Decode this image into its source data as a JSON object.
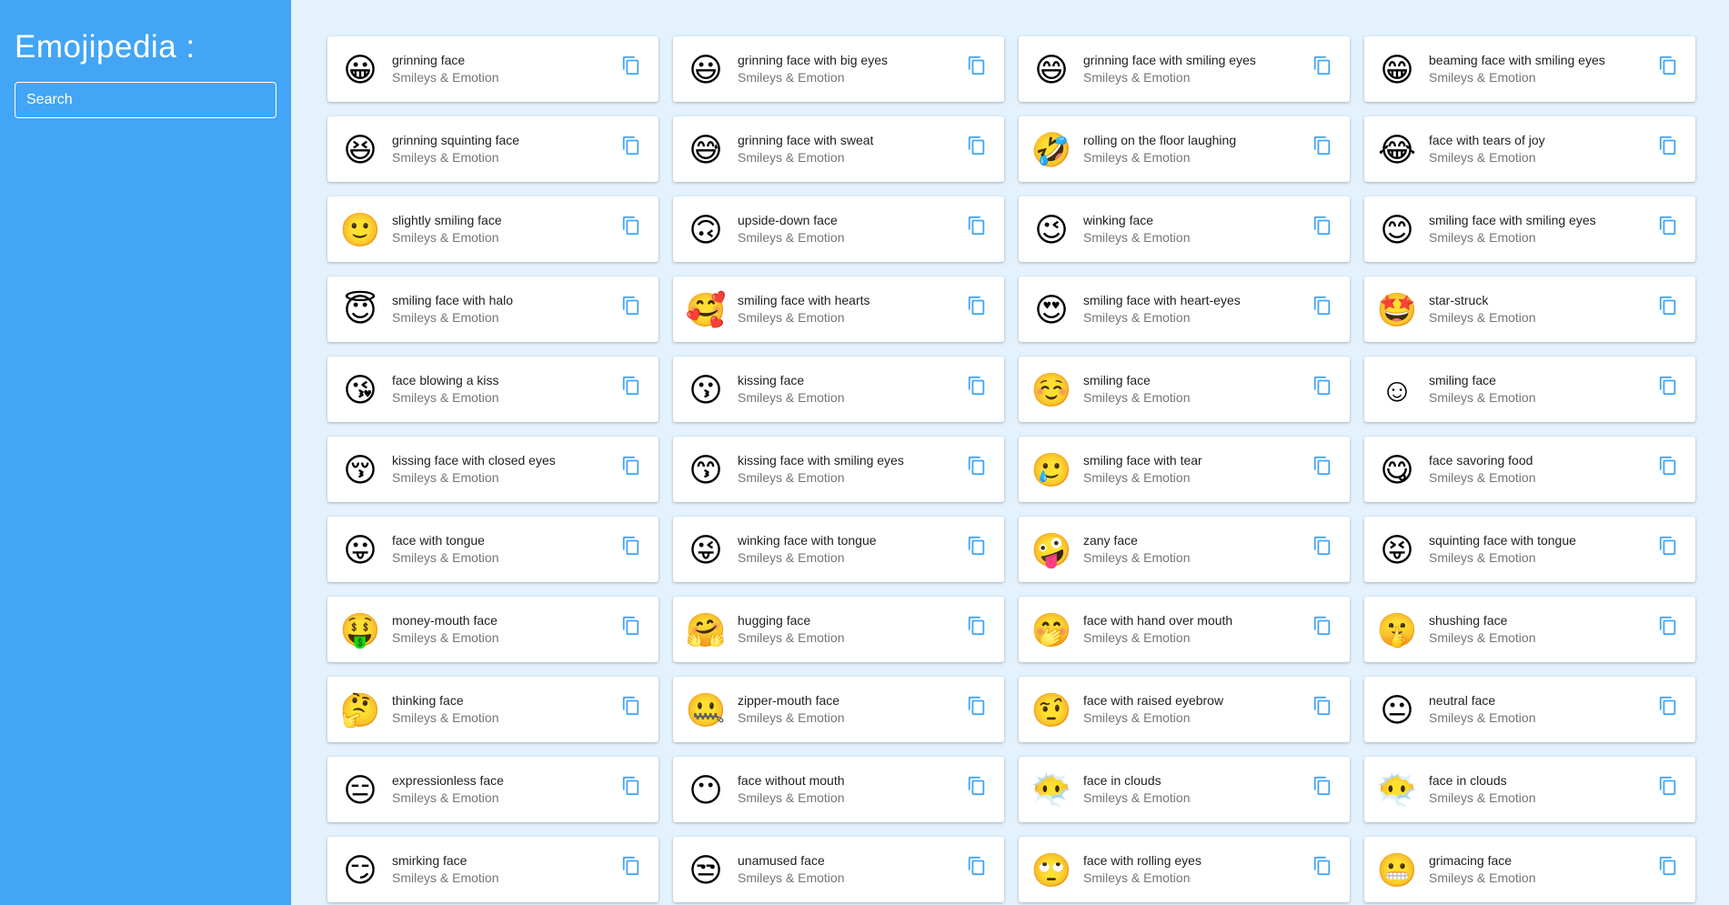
{
  "app": {
    "title": "Emojipedia :"
  },
  "search": {
    "placeholder": "Search",
    "value": ""
  },
  "colors": {
    "sidebar": "#42a5f5",
    "background": "#e3f2fd",
    "copy_icon": "#42a5f5"
  },
  "emojis": [
    {
      "emoji": "😀",
      "name": "grinning face",
      "category": "Smileys & Emotion"
    },
    {
      "emoji": "😃",
      "name": "grinning face with big eyes",
      "category": "Smileys & Emotion"
    },
    {
      "emoji": "😄",
      "name": "grinning face with smiling eyes",
      "category": "Smileys & Emotion"
    },
    {
      "emoji": "😁",
      "name": "beaming face with smiling eyes",
      "category": "Smileys & Emotion"
    },
    {
      "emoji": "😆",
      "name": "grinning squinting face",
      "category": "Smileys & Emotion"
    },
    {
      "emoji": "😅",
      "name": "grinning face with sweat",
      "category": "Smileys & Emotion"
    },
    {
      "emoji": "🤣",
      "name": "rolling on the floor laughing",
      "category": "Smileys & Emotion"
    },
    {
      "emoji": "😂",
      "name": "face with tears of joy",
      "category": "Smileys & Emotion"
    },
    {
      "emoji": "🙂",
      "name": "slightly smiling face",
      "category": "Smileys & Emotion"
    },
    {
      "emoji": "🙃",
      "name": "upside-down face",
      "category": "Smileys & Emotion"
    },
    {
      "emoji": "😉",
      "name": "winking face",
      "category": "Smileys & Emotion"
    },
    {
      "emoji": "😊",
      "name": "smiling face with smiling eyes",
      "category": "Smileys & Emotion"
    },
    {
      "emoji": "😇",
      "name": "smiling face with halo",
      "category": "Smileys & Emotion"
    },
    {
      "emoji": "🥰",
      "name": "smiling face with hearts",
      "category": "Smileys & Emotion"
    },
    {
      "emoji": "😍",
      "name": "smiling face with heart-eyes",
      "category": "Smileys & Emotion"
    },
    {
      "emoji": "🤩",
      "name": "star-struck",
      "category": "Smileys & Emotion"
    },
    {
      "emoji": "😘",
      "name": "face blowing a kiss",
      "category": "Smileys & Emotion"
    },
    {
      "emoji": "😗",
      "name": "kissing face",
      "category": "Smileys & Emotion"
    },
    {
      "emoji": "☺️",
      "name": "smiling face",
      "category": "Smileys & Emotion"
    },
    {
      "emoji": "☺",
      "name": "smiling face",
      "category": "Smileys & Emotion"
    },
    {
      "emoji": "😚",
      "name": "kissing face with closed eyes",
      "category": "Smileys & Emotion"
    },
    {
      "emoji": "😙",
      "name": "kissing face with smiling eyes",
      "category": "Smileys & Emotion"
    },
    {
      "emoji": "🥲",
      "name": "smiling face with tear",
      "category": "Smileys & Emotion"
    },
    {
      "emoji": "😋",
      "name": "face savoring food",
      "category": "Smileys & Emotion"
    },
    {
      "emoji": "😛",
      "name": "face with tongue",
      "category": "Smileys & Emotion"
    },
    {
      "emoji": "😜",
      "name": "winking face with tongue",
      "category": "Smileys & Emotion"
    },
    {
      "emoji": "🤪",
      "name": "zany face",
      "category": "Smileys & Emotion"
    },
    {
      "emoji": "😝",
      "name": "squinting face with tongue",
      "category": "Smileys & Emotion"
    },
    {
      "emoji": "🤑",
      "name": "money-mouth face",
      "category": "Smileys & Emotion"
    },
    {
      "emoji": "🤗",
      "name": "hugging face",
      "category": "Smileys & Emotion"
    },
    {
      "emoji": "🤭",
      "name": "face with hand over mouth",
      "category": "Smileys & Emotion"
    },
    {
      "emoji": "🤫",
      "name": "shushing face",
      "category": "Smileys & Emotion"
    },
    {
      "emoji": "🤔",
      "name": "thinking face",
      "category": "Smileys & Emotion"
    },
    {
      "emoji": "🤐",
      "name": "zipper-mouth face",
      "category": "Smileys & Emotion"
    },
    {
      "emoji": "🤨",
      "name": "face with raised eyebrow",
      "category": "Smileys & Emotion"
    },
    {
      "emoji": "😐",
      "name": "neutral face",
      "category": "Smileys & Emotion"
    },
    {
      "emoji": "😑",
      "name": "expressionless face",
      "category": "Smileys & Emotion"
    },
    {
      "emoji": "😶",
      "name": "face without mouth",
      "category": "Smileys & Emotion"
    },
    {
      "emoji": "😶‍🌫️",
      "name": "face in clouds",
      "category": "Smileys & Emotion"
    },
    {
      "emoji": "😶‍🌫",
      "name": "face in clouds",
      "category": "Smileys & Emotion"
    },
    {
      "emoji": "😏",
      "name": "smirking face",
      "category": "Smileys & Emotion"
    },
    {
      "emoji": "😒",
      "name": "unamused face",
      "category": "Smileys & Emotion"
    },
    {
      "emoji": "🙄",
      "name": "face with rolling eyes",
      "category": "Smileys & Emotion"
    },
    {
      "emoji": "😬",
      "name": "grimacing face",
      "category": "Smileys & Emotion"
    }
  ]
}
